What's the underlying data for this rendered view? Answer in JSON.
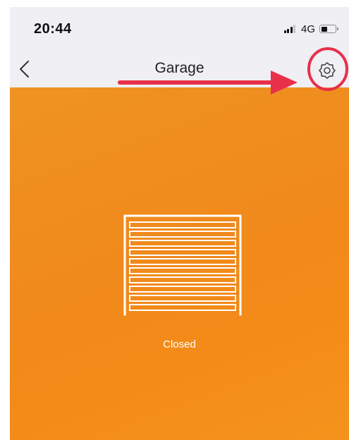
{
  "status_bar": {
    "time": "20:44",
    "network": "4G"
  },
  "nav": {
    "title": "Garage",
    "back_icon": "chevron-left-icon",
    "settings_icon": "gear-icon"
  },
  "device": {
    "icon": "garage-door-icon",
    "status": "Closed",
    "panel_color": "#f08a1c"
  },
  "annotation": {
    "color": "#e8304a"
  }
}
